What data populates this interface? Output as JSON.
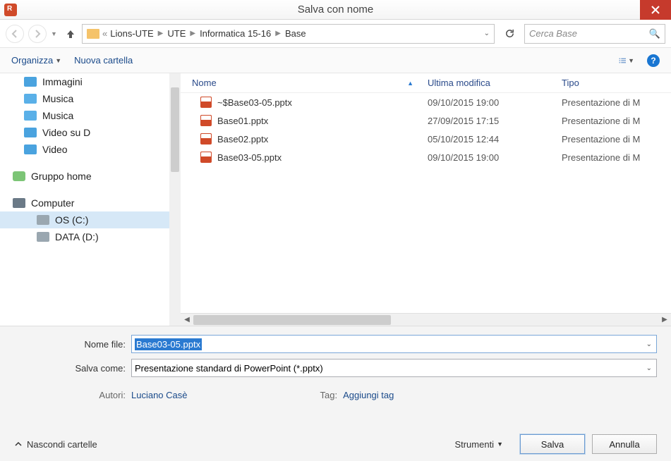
{
  "window": {
    "title": "Salva con nome"
  },
  "breadcrumb": {
    "items": [
      "Lions-UTE",
      "UTE",
      "Informatica 15-16",
      "Base"
    ]
  },
  "search": {
    "placeholder": "Cerca Base"
  },
  "toolbar": {
    "organize": "Organizza",
    "new_folder": "Nuova cartella"
  },
  "sidebar": {
    "items": [
      {
        "label": "Immagini"
      },
      {
        "label": "Musica"
      },
      {
        "label": "Musica"
      },
      {
        "label": "Video su D"
      },
      {
        "label": "Video"
      }
    ],
    "homegroup": "Gruppo home",
    "computer": "Computer",
    "drives": [
      {
        "label": "OS (C:)"
      },
      {
        "label": "DATA (D:)"
      }
    ]
  },
  "files": {
    "headers": {
      "name": "Nome",
      "modified": "Ultima modifica",
      "type": "Tipo"
    },
    "rows": [
      {
        "name": "~$Base03-05.pptx",
        "modified": "09/10/2015 19:00",
        "type": "Presentazione di M"
      },
      {
        "name": "Base01.pptx",
        "modified": "27/09/2015 17:15",
        "type": "Presentazione di M"
      },
      {
        "name": "Base02.pptx",
        "modified": "05/10/2015 12:44",
        "type": "Presentazione di M"
      },
      {
        "name": "Base03-05.pptx",
        "modified": "09/10/2015 19:00",
        "type": "Presentazione di M"
      }
    ]
  },
  "form": {
    "filename_label": "Nome file:",
    "filename_value": "Base03-05.pptx",
    "savetype_label": "Salva come:",
    "savetype_value": "Presentazione standard di PowerPoint (*.pptx)",
    "authors_label": "Autori:",
    "authors_value": "Luciano Casè",
    "tag_label": "Tag:",
    "tag_value": "Aggiungi tag"
  },
  "actions": {
    "hide_folders": "Nascondi cartelle",
    "tools": "Strumenti",
    "save": "Salva",
    "cancel": "Annulla"
  }
}
